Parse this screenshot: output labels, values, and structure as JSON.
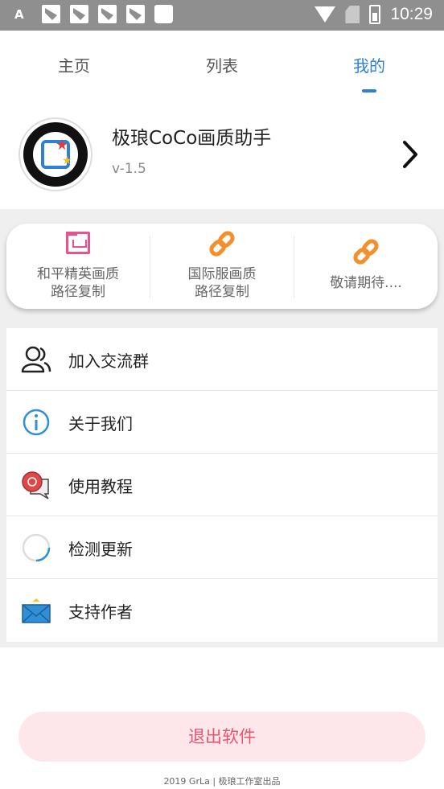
{
  "status_bar": {
    "left_label": "A",
    "time": "10:29"
  },
  "tabs": [
    {
      "label": "主页",
      "active": false
    },
    {
      "label": "列表",
      "active": false
    },
    {
      "label": "我的",
      "active": true
    }
  ],
  "accent_color": "#2f7fd3",
  "profile": {
    "app_name": "极琅CoCo画质助手",
    "version": "v-1.5"
  },
  "quick_actions": [
    {
      "label_line1": "和平精英画质",
      "label_line2": "路径复制",
      "icon": "folder-icon",
      "color": "#e8528d"
    },
    {
      "label_line1": "国际服画质",
      "label_line2": "路径复制",
      "icon": "link-icon",
      "color": "#f3902e"
    },
    {
      "label_line1": "敬请期待....",
      "label_line2": "",
      "icon": "link-icon",
      "color": "#f3902e"
    }
  ],
  "menu": [
    {
      "label": "加入交流群",
      "icon": "users-icon"
    },
    {
      "label": "关于我们",
      "icon": "info-icon"
    },
    {
      "label": "使用教程",
      "icon": "chat-bubble-icon"
    },
    {
      "label": "检测更新",
      "icon": "loading-circle-icon"
    },
    {
      "label": "支持作者",
      "icon": "envelope-icon"
    }
  ],
  "exit_button": {
    "label": "退出软件",
    "color": "#e9566f"
  },
  "footer": {
    "text": "2019 GrLa | 极琅工作室出品"
  }
}
